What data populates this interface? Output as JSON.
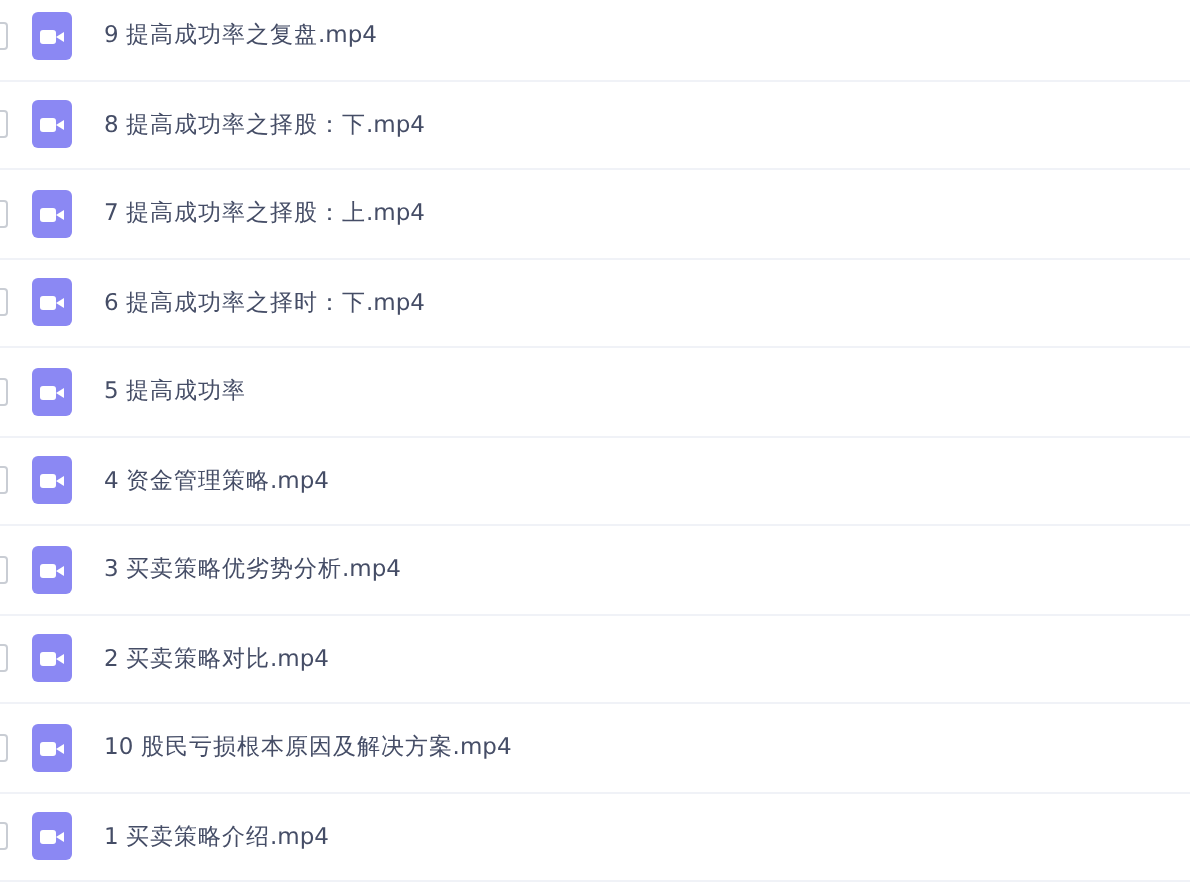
{
  "files": [
    {
      "name": "9 提高成功率之复盘.mp4",
      "checked": false
    },
    {
      "name": "8 提高成功率之择股：下.mp4",
      "checked": false
    },
    {
      "name": "7 提高成功率之择股：上.mp4",
      "checked": false
    },
    {
      "name": "6 提高成功率之择时：下.mp4",
      "checked": false
    },
    {
      "name": "5 提高成功率",
      "checked": false
    },
    {
      "name": "4 资金管理策略.mp4",
      "checked": false
    },
    {
      "name": "3 买卖策略优劣势分析.mp4",
      "checked": false
    },
    {
      "name": "2 买卖策略对比.mp4",
      "checked": false
    },
    {
      "name": "10 股民亏损根本原因及解决方案.mp4",
      "checked": false
    },
    {
      "name": "1 买卖策略介绍.mp4",
      "checked": false
    }
  ]
}
